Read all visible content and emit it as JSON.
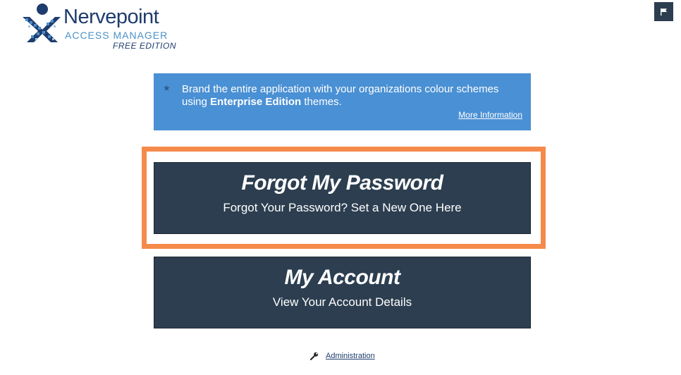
{
  "brand": {
    "name": "Nervepoint",
    "product": "ACCESS MANAGER",
    "edition": "FREE EDITION"
  },
  "header": {
    "flag_icon": "flag-icon"
  },
  "promo": {
    "text_before": "Brand the entire application with your organizations colour schemes using ",
    "text_bold": "Enterprise Edition",
    "text_after": " themes.",
    "link_label": "More Information",
    "icon": "star-icon",
    "bg_color": "#4a90d4"
  },
  "tiles": [
    {
      "title": "Forgot My Password",
      "subtitle": "Forgot Your Password? Set a New One Here"
    },
    {
      "title": "My Account",
      "subtitle": "View Your Account Details"
    }
  ],
  "footer": {
    "admin_label": "Administration",
    "admin_icon": "wrench-icon"
  },
  "colors": {
    "tile_bg": "#2c3e50",
    "highlight": "#f58a4b",
    "brand_dark": "#1f3c6e",
    "brand_light": "#4a90c8"
  }
}
